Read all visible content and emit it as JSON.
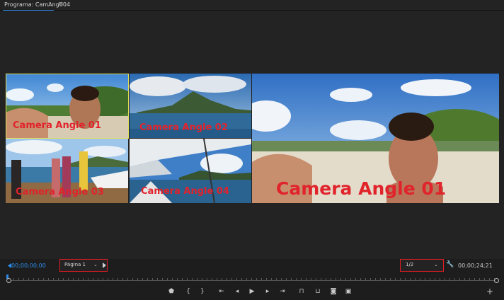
{
  "panel": {
    "title": "Programa: CamAng004",
    "menu_icon": "hamburger-icon"
  },
  "multicam": {
    "cameras": [
      {
        "label": "Camera Angle 01"
      },
      {
        "label": "Camera Angle 02"
      },
      {
        "label": "Camera Angle 03"
      },
      {
        "label": "Camera Angle 04"
      }
    ]
  },
  "program": {
    "label": "Camera Angle 01"
  },
  "controls": {
    "playhead_timecode": "00;00;00;00",
    "page_select": "Página 1",
    "resolution_select": "1/2",
    "duration_timecode": "00;00;24;21"
  },
  "transport": {
    "buttons": [
      "add-marker-icon",
      "mark-in-icon",
      "mark-out-icon",
      "go-to-in-icon",
      "step-back-icon",
      "play-icon",
      "step-forward-icon",
      "go-to-out-icon",
      "lift-icon",
      "extract-icon",
      "export-frame-icon",
      "multicam-toggle-icon",
      "button-editor-icon"
    ]
  },
  "colors": {
    "accent": "#2d8ceb",
    "annotation_red": "#e41c24",
    "active_camera": "#e3e05a",
    "panel_bg": "#232323"
  }
}
